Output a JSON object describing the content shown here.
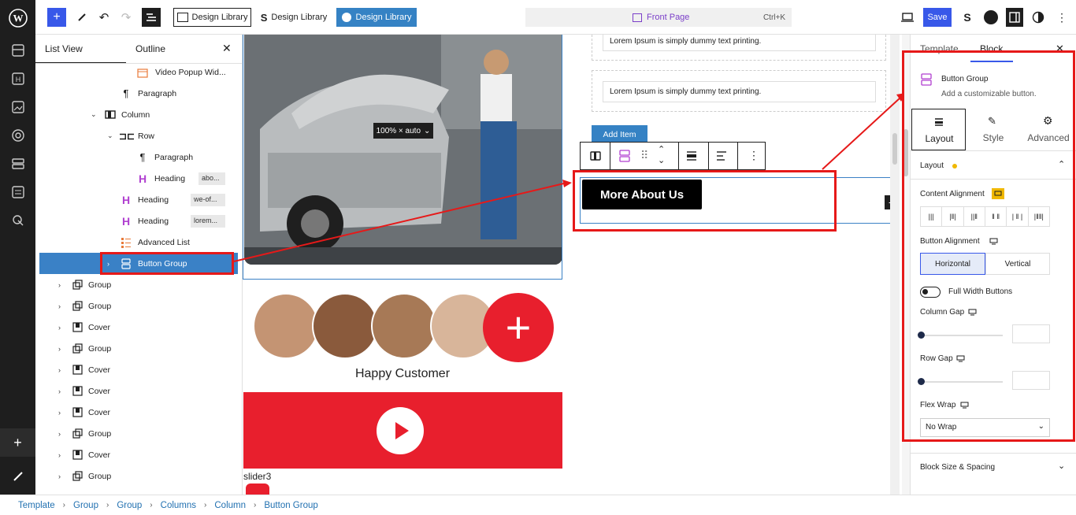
{
  "topbar": {
    "design_library_1": "Design Library",
    "design_library_2": "Design Library",
    "design_library_3": "Design Library",
    "page_name": "Front Page",
    "shortcut": "Ctrl+K",
    "save_label": "Save"
  },
  "listview": {
    "tab_list": "List View",
    "tab_outline": "Outline",
    "items": [
      {
        "label": "Video Popup Wid...",
        "badge": ""
      },
      {
        "label": "Paragraph",
        "badge": ""
      },
      {
        "label": "Column",
        "badge": ""
      },
      {
        "label": "Row",
        "badge": ""
      },
      {
        "label": "Paragraph",
        "badge": ""
      },
      {
        "label": "Heading",
        "badge": "abo..."
      },
      {
        "label": "Heading",
        "badge": "we-of..."
      },
      {
        "label": "Heading",
        "badge": "lorem..."
      },
      {
        "label": "Advanced List",
        "badge": ""
      },
      {
        "label": "Button Group",
        "badge": ""
      },
      {
        "label": "Group",
        "badge": ""
      },
      {
        "label": "Group",
        "badge": ""
      },
      {
        "label": "Cover",
        "badge": ""
      },
      {
        "label": "Group",
        "badge": ""
      },
      {
        "label": "Cover",
        "badge": ""
      },
      {
        "label": "Cover",
        "badge": ""
      },
      {
        "label": "Cover",
        "badge": ""
      },
      {
        "label": "Group",
        "badge": ""
      },
      {
        "label": "Cover",
        "badge": ""
      },
      {
        "label": "Group",
        "badge": ""
      }
    ]
  },
  "canvas": {
    "image_size": "100% × auto",
    "lorem_1": "Lorem Ipsum is simply dummy text printing.",
    "lorem_2": "Lorem Ipsum is simply dummy text printing.",
    "add_item": "Add Item",
    "more_about": "More About Us",
    "happy_customer": "Happy Customer",
    "slider_label": "slider3"
  },
  "inspector": {
    "tab_template": "Template",
    "tab_block": "Block",
    "block_name": "Button Group",
    "block_desc": "Add a customizable button.",
    "tabs": {
      "layout": "Layout",
      "style": "Style",
      "advanced": "Advanced"
    },
    "section_layout": "Layout",
    "content_alignment": "Content Alignment",
    "button_alignment": "Button Alignment",
    "horizontal": "Horizontal",
    "vertical": "Vertical",
    "full_width": "Full Width Buttons",
    "column_gap": "Column Gap",
    "row_gap": "Row Gap",
    "flex_wrap": "Flex Wrap",
    "flex_wrap_value": "No Wrap",
    "block_size": "Block Size & Spacing"
  },
  "breadcrumbs": [
    "Template",
    "Group",
    "Group",
    "Columns",
    "Column",
    "Button Group"
  ],
  "colors": {
    "accent": "#3858e9",
    "highlight": "#e61919",
    "selected_row": "#3a81c6",
    "brand_red": "#e81f2d"
  }
}
